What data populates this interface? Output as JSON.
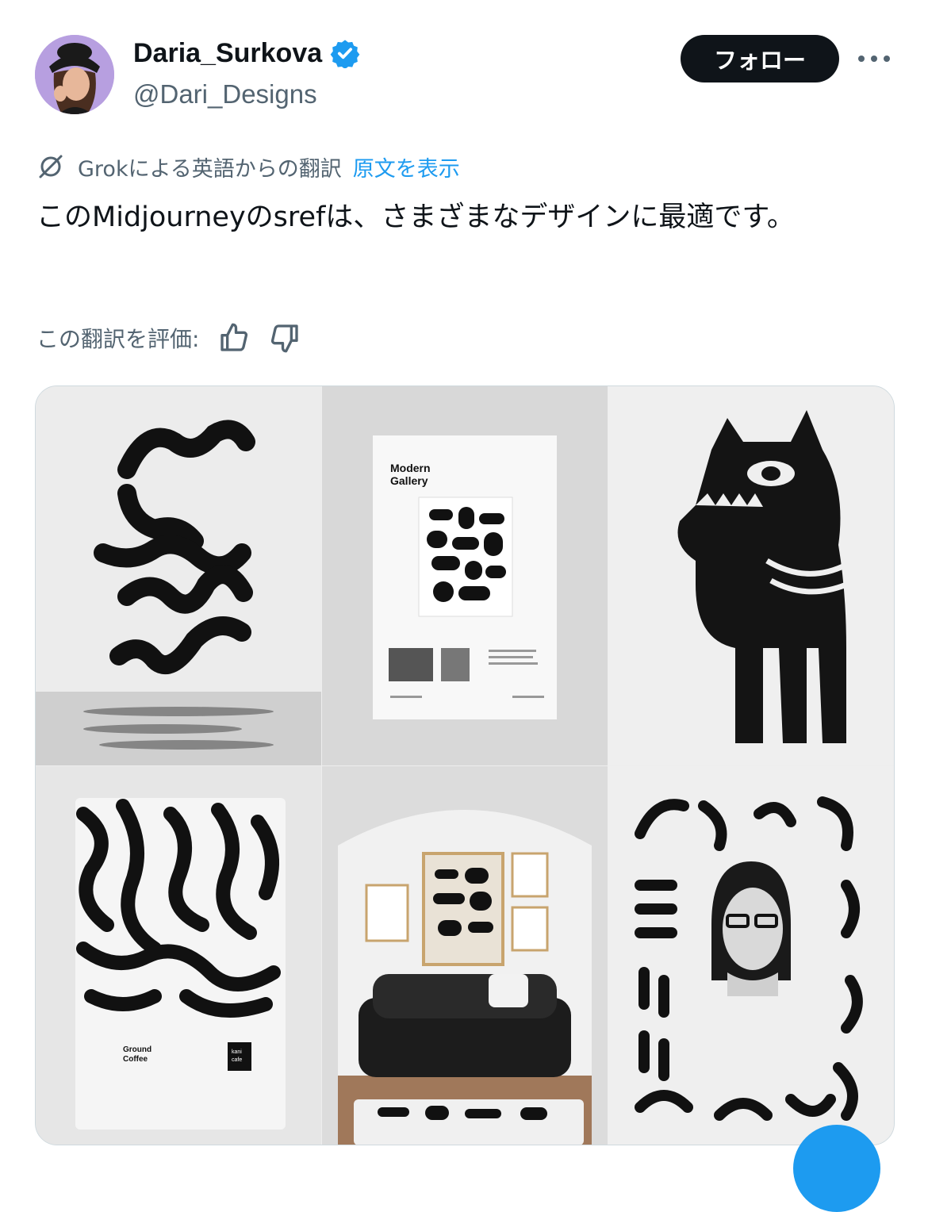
{
  "author": {
    "display_name": "Daria_Surkova",
    "handle": "@Dari_Designs",
    "verified": true
  },
  "actions": {
    "follow_label": "フォロー",
    "more_icon": "more-horizontal-icon"
  },
  "translation": {
    "notice": "Grokによる英語からの翻訳",
    "show_original": "原文を表示",
    "icon": "grok-icon"
  },
  "tweet": {
    "text": "このMidjourneyのsrefは、さまざまなデザインに最適です。"
  },
  "rating": {
    "label": "この翻訳を評価:",
    "up_icon": "thumbs-up-icon",
    "down_icon": "thumbs-down-icon"
  },
  "media": {
    "poster": {
      "title_line1": "Modern",
      "title_line2": "Gallery"
    },
    "coffee": {
      "title_line1": "Ground",
      "title_line2": "Coffee",
      "brand_line1": "kani",
      "brand_line2": "cafe"
    }
  },
  "colors": {
    "accent": "#1d9bf0",
    "text_primary": "#0f1419",
    "text_secondary": "#536471",
    "follow_bg": "#0f1419"
  }
}
